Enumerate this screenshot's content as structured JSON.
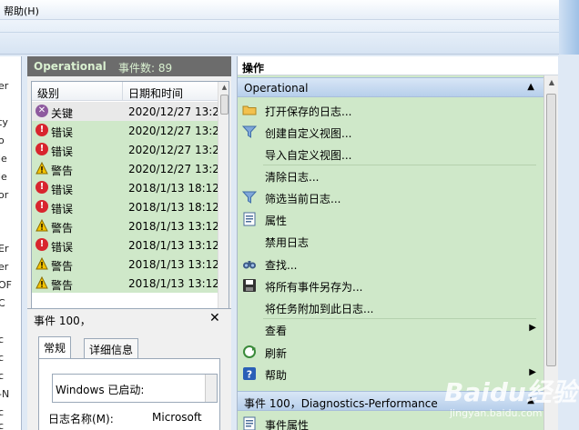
{
  "menu": {
    "help": "帮助(H)"
  },
  "tree": {
    "items": [
      "er",
      "ty",
      "o",
      "le",
      "le",
      "or",
      "Er",
      "er",
      "OF",
      "C",
      "c",
      "c",
      "c",
      "-N",
      "c",
      "c"
    ]
  },
  "event_list": {
    "log_name": "Operational",
    "count_label": "事件数: 89",
    "columns": [
      "级别",
      "日期和时间"
    ],
    "rows": [
      {
        "level": "关键",
        "type": "critical",
        "datetime": "2020/12/27 13:2"
      },
      {
        "level": "错误",
        "type": "error",
        "datetime": "2020/12/27 13:2"
      },
      {
        "level": "错误",
        "type": "error",
        "datetime": "2020/12/27 13:2"
      },
      {
        "level": "警告",
        "type": "warning",
        "datetime": "2020/12/27 13:2"
      },
      {
        "level": "错误",
        "type": "error",
        "datetime": "2018/1/13 18:12"
      },
      {
        "level": "错误",
        "type": "error",
        "datetime": "2018/1/13 18:12"
      },
      {
        "level": "警告",
        "type": "warning",
        "datetime": "2018/1/13 13:12"
      },
      {
        "level": "错误",
        "type": "error",
        "datetime": "2018/1/13 13:12"
      },
      {
        "level": "警告",
        "type": "warning",
        "datetime": "2018/1/13 13:12"
      },
      {
        "level": "警告",
        "type": "warning",
        "datetime": "2018/1/13 13:12"
      }
    ]
  },
  "detail": {
    "title": "事件 100，",
    "tabs": [
      "常规",
      "详细信息"
    ],
    "message": "Windows 已启动:",
    "log_name_label": "日志名称(M):",
    "log_name_value": "Microsoft"
  },
  "actions": {
    "header": "操作",
    "section1": "Operational",
    "items": [
      {
        "label": "打开保存的日志...",
        "icon": "folder-icon"
      },
      {
        "label": "创建自定义视图...",
        "icon": "filter-icon"
      },
      {
        "label": "导入自定义视图...",
        "icon": ""
      },
      {
        "label": "清除日志...",
        "icon": ""
      },
      {
        "label": "筛选当前日志...",
        "icon": "filter-icon"
      },
      {
        "label": "属性",
        "icon": "properties-icon"
      },
      {
        "label": "禁用日志",
        "icon": ""
      },
      {
        "label": "查找...",
        "icon": "binoculars-icon"
      },
      {
        "label": "将所有事件另存为...",
        "icon": "save-icon"
      },
      {
        "label": "将任务附加到此日志...",
        "icon": ""
      },
      {
        "label": "查看",
        "icon": ""
      },
      {
        "label": "刷新",
        "icon": "refresh-icon"
      },
      {
        "label": "帮助",
        "icon": "help-icon"
      }
    ],
    "section2": "事件 100，Diagnostics-Performance",
    "section2_item": "事件属性"
  },
  "watermark": {
    "text": "Baidu经验",
    "sub": "jingyan.baidu.com"
  },
  "colors": {
    "row_green": "#cfe8c9",
    "header_gray": "#6c6c6c",
    "section_blue": "#b7cfeb"
  }
}
